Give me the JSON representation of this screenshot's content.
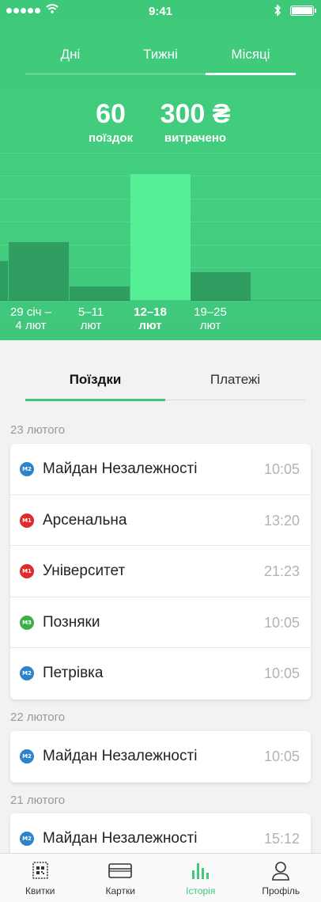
{
  "status_bar": {
    "time": "9:41"
  },
  "period_tabs": [
    {
      "label": "Дні"
    },
    {
      "label": "Тижні"
    },
    {
      "label": "Місяці"
    }
  ],
  "active_period": "Місяці",
  "stats": {
    "trips_value": "60",
    "trips_label": "поїздок",
    "spent_value": "300 ₴",
    "spent_label": "витрачено"
  },
  "chart_data": {
    "type": "bar",
    "categories": [
      "",
      "29 січ – 4 лют",
      "5–11 лют",
      "12–18 лют",
      "19–25 лют"
    ],
    "values": [
      0.25,
      0.37,
      0.09,
      0.8,
      0.18
    ],
    "selected_index": 3,
    "ylim": [
      0,
      1
    ]
  },
  "week_labels": [
    {
      "line1": "29 січ –",
      "line2": "4 лют"
    },
    {
      "line1": "5–11",
      "line2": "лют"
    },
    {
      "line1": "12–18",
      "line2": "лют"
    },
    {
      "line1": "19–25",
      "line2": "лют"
    }
  ],
  "segment": [
    {
      "label": "Поїздки"
    },
    {
      "label": "Платежі"
    }
  ],
  "groups": [
    {
      "date": "23 лютого",
      "rides": [
        {
          "line": "M2",
          "color": "#2d83cc",
          "station": "Майдан Незалежності",
          "time": "10:05"
        },
        {
          "line": "M1",
          "color": "#e2282d",
          "station": "Арсенальна",
          "time": "13:20"
        },
        {
          "line": "M1",
          "color": "#e2282d",
          "station": "Університет",
          "time": "21:23"
        },
        {
          "line": "M3",
          "color": "#3caf4b",
          "station": "Позняки",
          "time": "10:05"
        },
        {
          "line": "M2",
          "color": "#2d83cc",
          "station": "Петрівка",
          "time": "10:05"
        }
      ]
    },
    {
      "date": "22 лютого",
      "rides": [
        {
          "line": "M2",
          "color": "#2d83cc",
          "station": "Майдан Незалежності",
          "time": "10:05"
        }
      ]
    },
    {
      "date": "21 лютого",
      "rides": [
        {
          "line": "M2",
          "color": "#2d83cc",
          "station": "Майдан Незалежності",
          "time": "15:12"
        }
      ]
    }
  ],
  "tab_bar": [
    {
      "label": "Квитки",
      "icon": "ticket-icon"
    },
    {
      "label": "Картки",
      "icon": "card-icon"
    },
    {
      "label": "Історія",
      "icon": "history-chart-icon"
    },
    {
      "label": "Профіль",
      "icon": "profile-icon"
    }
  ],
  "colors": {
    "accent": "#3ec87a",
    "bar": "#2f9e60",
    "bar_selected": "#55ef96"
  }
}
